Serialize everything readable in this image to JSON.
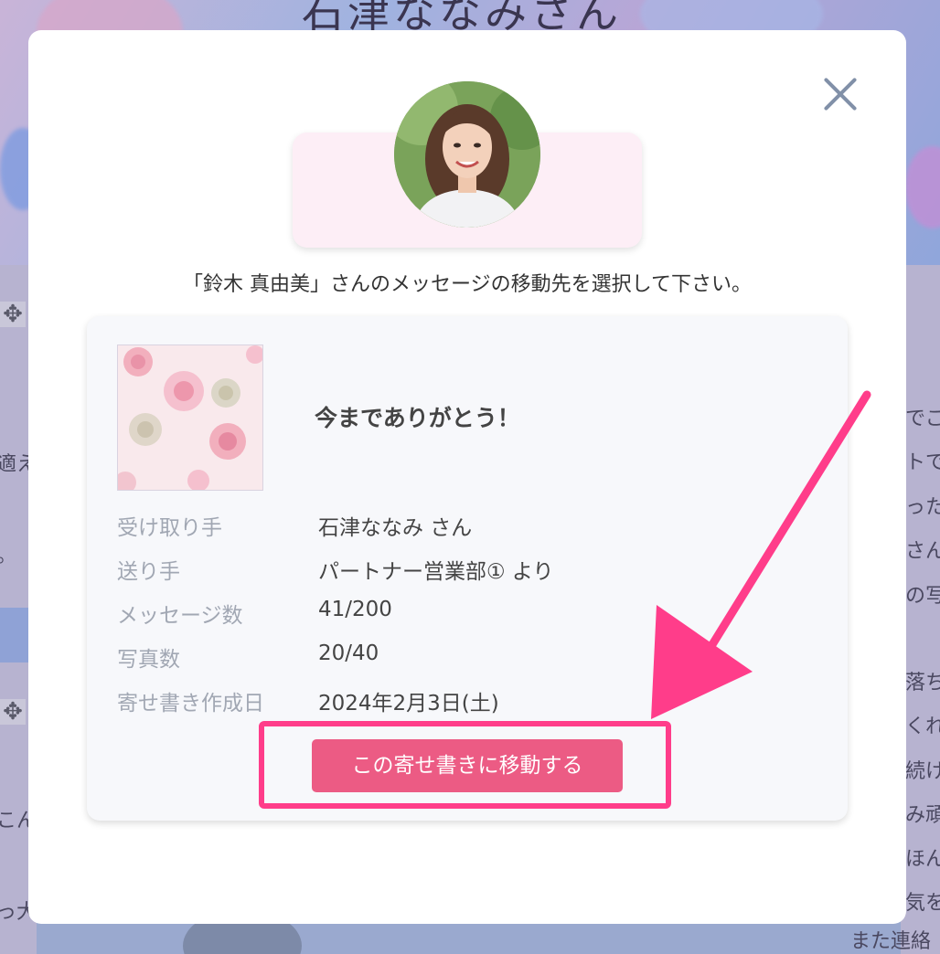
{
  "background": {
    "page_title_partial": "石津ななみさん",
    "right_text_fragments": [
      "でご",
      "トで",
      "った",
      "さん",
      "の写",
      "落ち",
      "くれ",
      "続け",
      "み頑",
      "ほん",
      "気を",
      "また連絡"
    ],
    "left_text_fragments": [
      "適え",
      "。",
      "こん",
      "っ大"
    ]
  },
  "modal": {
    "close_label": "×",
    "instruction": "「鈴木 真由美」さんのメッセージの移動先を選択して下さい。",
    "card": {
      "title": "今までありがとう！",
      "rows": [
        {
          "label": "受け取り手",
          "value": "石津ななみ さん"
        },
        {
          "label": "送り手",
          "value": "パートナー営業部① より"
        },
        {
          "label": "メッセージ数",
          "value": "41/200"
        },
        {
          "label": "写真数",
          "value": "20/40"
        },
        {
          "label": "寄せ書き作成日",
          "value": "2024年2月3日(土)"
        }
      ],
      "move_button_label": "この寄せ書きに移動する"
    }
  },
  "colors": {
    "accent_pink": "#ec5b84",
    "annotation_pink": "#ff3d8a",
    "pill_pink": "#fdeef6",
    "label_gray": "#a1a7b3"
  }
}
